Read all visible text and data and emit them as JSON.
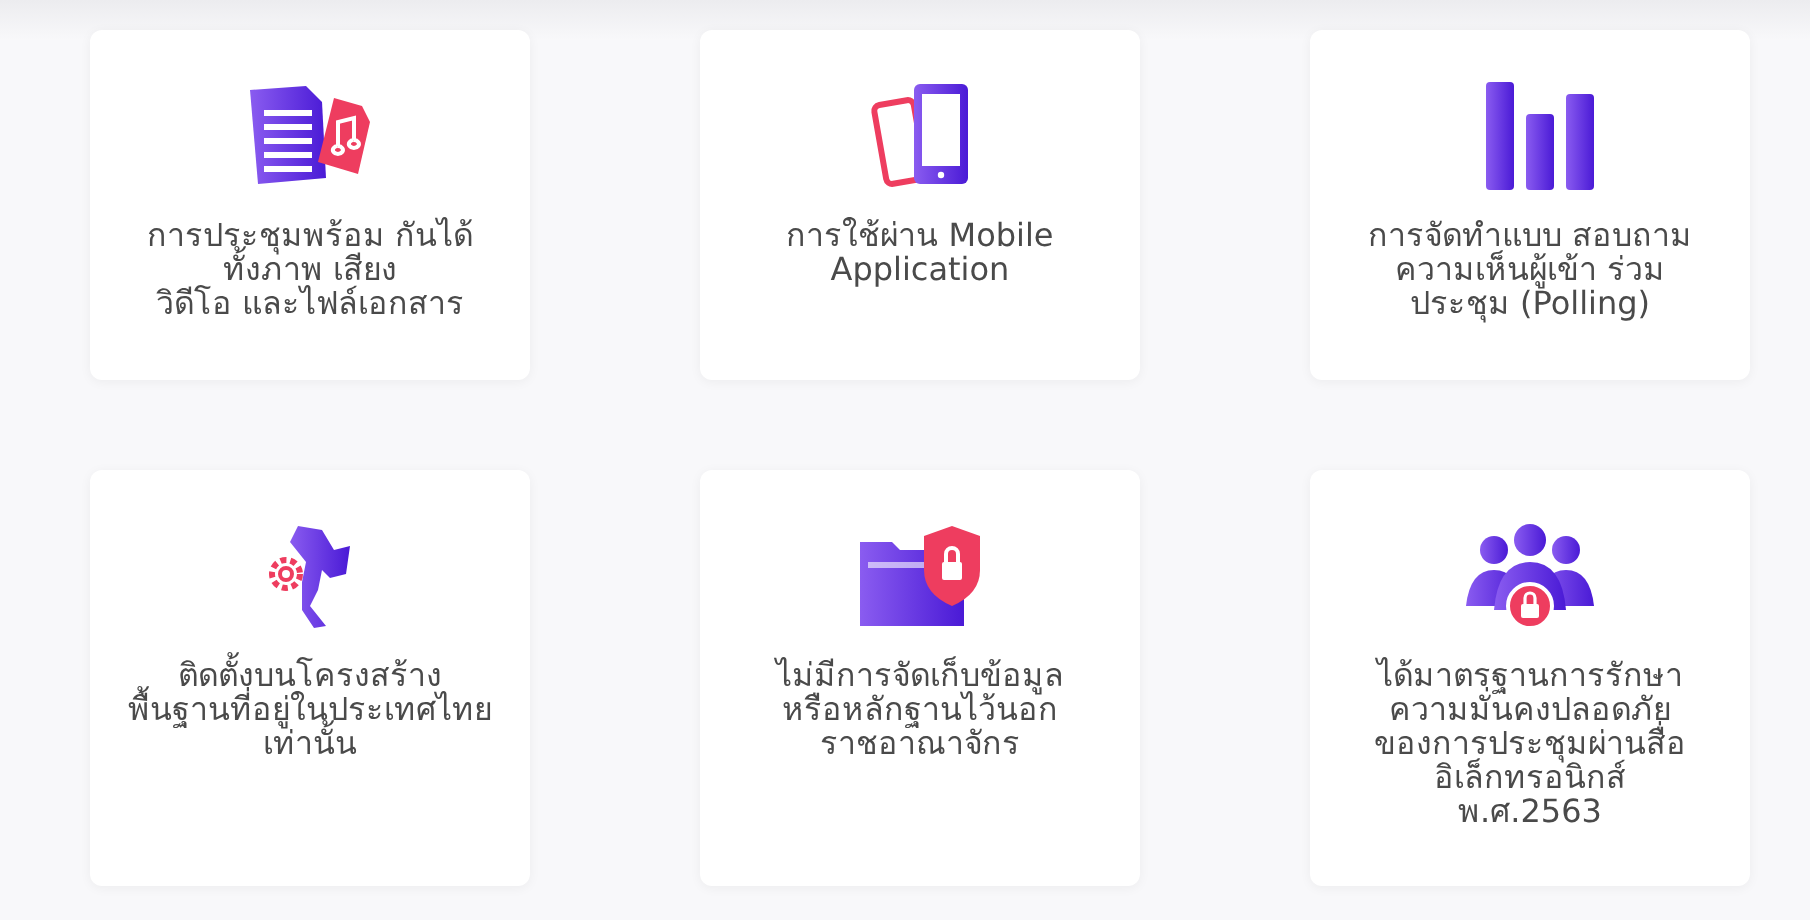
{
  "features": [
    {
      "lines": [
        "การประชุมพร้อม กันได้",
        "ทั้งภาพ เสียง",
        "วิดีโอ และไฟล์เอกสาร"
      ]
    },
    {
      "lines": [
        "การใช้ผ่าน Mobile",
        "Application"
      ]
    },
    {
      "lines": [
        "การจัดทำแบบ สอบถาม",
        "ความเห็นผู้เข้า ร่วม",
        "ประชุม (Polling)"
      ]
    },
    {
      "lines": [
        "ติดตั้งบนโครงสร้าง",
        "พื้นฐานที่อยู่ในประเทศไทย",
        "เท่านั้น"
      ]
    },
    {
      "lines": [
        "ไม่มีการจัดเก็บข้อมูล",
        "หรือหลักฐานไว้นอก",
        "ราชอาณาจักร"
      ]
    },
    {
      "lines": [
        "ได้มาตรฐานการรักษา",
        "ความมั่นคงปลอดภัย",
        "ของการประชุมผ่านสื่อ",
        "อิเล็กทรอนิกส์",
        "พ.ศ.2563"
      ]
    }
  ]
}
